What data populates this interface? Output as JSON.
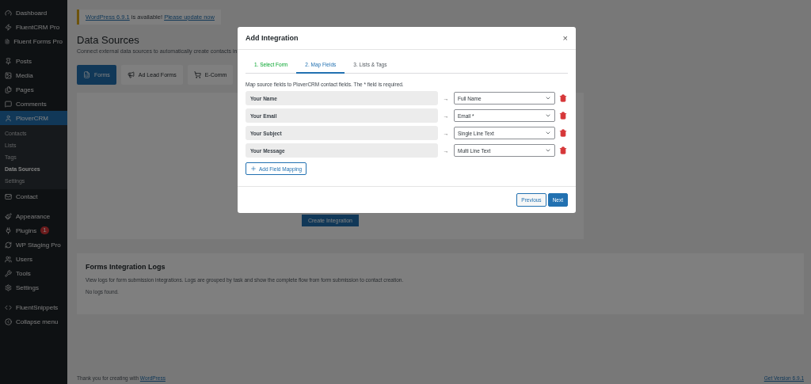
{
  "sidebar": {
    "items": [
      {
        "label": "Dashboard",
        "selected": false
      },
      {
        "label": "FluentCRM Pro",
        "selected": false
      },
      {
        "label": "Fluent Forms Pro",
        "selected": false,
        "gap_after": true
      },
      {
        "label": "Posts",
        "selected": false
      },
      {
        "label": "Media",
        "selected": false
      },
      {
        "label": "Pages",
        "selected": false
      },
      {
        "label": "Comments",
        "selected": false
      },
      {
        "label": "PloverCRM",
        "selected": true,
        "children": [
          {
            "label": "Contacts",
            "selected": false
          },
          {
            "label": "Lists",
            "selected": false
          },
          {
            "label": "Tags",
            "selected": false
          },
          {
            "label": "Data Sources",
            "selected": true
          },
          {
            "label": "Settings",
            "selected": false
          }
        ]
      },
      {
        "label": "Contact",
        "selected": false,
        "gap_after": true
      },
      {
        "label": "Appearance",
        "selected": false
      },
      {
        "label": "Plugins",
        "selected": false,
        "badge": "1"
      },
      {
        "label": "WP Staging Pro",
        "selected": false
      },
      {
        "label": "Users",
        "selected": false
      },
      {
        "label": "Tools",
        "selected": false
      },
      {
        "label": "Settings",
        "selected": false,
        "gap_after": true
      },
      {
        "label": "FluentSnippets",
        "selected": false
      },
      {
        "label": "Collapse menu",
        "selected": false
      }
    ]
  },
  "notice": {
    "link": "WordPress 6.9.1",
    "text": "is available!",
    "action": "Please update now"
  },
  "page": {
    "title": "Data Sources",
    "subtitle": "Connect external data sources to automatically create contacts in"
  },
  "source_tabs": [
    {
      "label": "Forms",
      "selected": true
    },
    {
      "label": "Ad Lead Forms",
      "selected": false
    },
    {
      "label": "E-Comm",
      "selected": false
    }
  ],
  "create_button": "Create Integration",
  "logs": {
    "title": "Forms Integration Logs",
    "description": "View logs for form submission integrations. Logs are grouped by task and show the complete flow from form submission to contact creation.",
    "empty": "No logs found."
  },
  "footer": {
    "text": "Thank you for creating with",
    "link": "WordPress",
    "version": "Get Version 6.9.1"
  },
  "dialog": {
    "title": "Add Integration",
    "close": "×",
    "steps": [
      {
        "label": "1. Select Form",
        "selected": false,
        "completed": true
      },
      {
        "label": "2. Map Fields",
        "selected": true,
        "completed": false
      },
      {
        "label": "3. Lists & Tags",
        "selected": false,
        "completed": false
      }
    ],
    "hint": "Map source fields to PloverCRM contact fields. The * field is required.",
    "mappings": [
      {
        "source": "Your Name",
        "arrow": "→",
        "target": "Full Name"
      },
      {
        "source": "Your Email",
        "arrow": "→",
        "target": "Email *"
      },
      {
        "source": "Your Subject",
        "arrow": "→",
        "target": "Single Line Text"
      },
      {
        "source": "Your Message",
        "arrow": "→",
        "target": "Multi Line Text"
      }
    ],
    "add_button": "Add Field Mapping",
    "buttons": [
      {
        "label": "Previous",
        "kind": "secondary"
      },
      {
        "label": "Next",
        "kind": "primary"
      }
    ]
  }
}
